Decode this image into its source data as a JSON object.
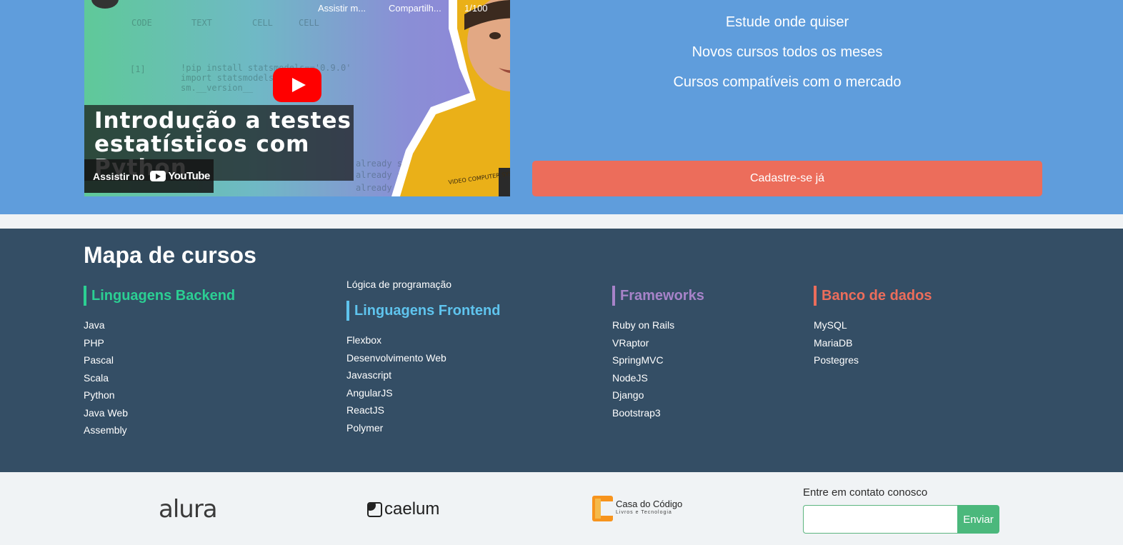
{
  "video": {
    "top_actions": {
      "watch_later": "Assistir m...",
      "share": "Compartilh...",
      "counter": "1/100"
    },
    "code_tabs": [
      "CODE",
      "TEXT",
      "CELL",
      "CELL"
    ],
    "code_lines": [
      "[1]",
      "!pip install statsmodels=='0.9.0'",
      "import statsmodels",
      "sm.__version__",
      "already satis",
      "already satis",
      "already satis"
    ],
    "title": "Introdução a testes\nestatísticos com\nPython",
    "watch_on": "Assistir no",
    "youtube_label": "YouTube",
    "shirt_text": "VIDEO COMPUTER SYSTEM"
  },
  "hero": {
    "features": [
      "Estude onde quiser",
      "Novos cursos todos os meses",
      "Cursos compatíveis com o mercado"
    ],
    "cta_label": "Cadastre-se já"
  },
  "course_map": {
    "title": "Mapa de cursos",
    "extra_link": "Lógica de programação",
    "categories": [
      {
        "name": "Linguagens Backend",
        "color": "#2bcf93",
        "items": [
          "Java",
          "PHP",
          "Pascal",
          "Scala",
          "Python",
          "Java Web",
          "Assembly"
        ]
      },
      {
        "name": "Linguagens Frontend",
        "color": "#5fc4ee",
        "items": [
          "Flexbox",
          "Desenvolvimento Web",
          "Javascript",
          "AngularJS",
          "ReactJS",
          "Polymer"
        ]
      },
      {
        "name": "Frameworks",
        "color": "#a783c9",
        "items": [
          "Ruby on Rails",
          "VRaptor",
          "SpringMVC",
          "NodeJS",
          "Django",
          "Bootstrap3"
        ]
      },
      {
        "name": "Banco de dados",
        "color": "#ec6d5b",
        "items": [
          "MySQL",
          "MariaDB",
          "Postegres"
        ]
      }
    ]
  },
  "footer": {
    "brands": {
      "alura": "alura",
      "caelum": "caelum",
      "casa_title": "Casa do Código",
      "casa_sub": "Livros e Tecnologia"
    },
    "contact_label": "Entre em contato conosco",
    "contact_placeholder": "",
    "send_label": "Enviar"
  }
}
